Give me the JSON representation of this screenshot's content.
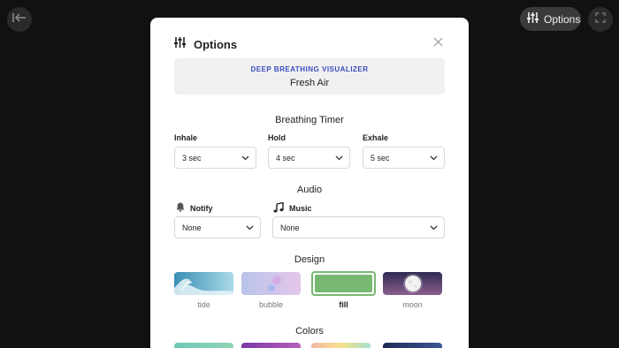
{
  "toolbar": {
    "back_icon": "exit-left-arrow-icon",
    "options_label": "Options",
    "options_icon": "sliders-icon",
    "expand_icon": "fullscreen-icon"
  },
  "modal": {
    "title": "Options",
    "title_icon": "sliders-icon",
    "close_icon": "close-icon",
    "subtitle": "DEEP BREATHING VISUALIZER",
    "preset_name": "Fresh Air",
    "accent_color": "#3b4dbf",
    "timer": {
      "heading": "Breathing Timer",
      "inhale": {
        "label": "Inhale",
        "value": "3 sec"
      },
      "hold": {
        "label": "Hold",
        "value": "4 sec"
      },
      "exhale": {
        "label": "Exhale",
        "value": "5 sec"
      }
    },
    "audio": {
      "heading": "Audio",
      "notify": {
        "label": "Notify",
        "icon": "bell-icon",
        "value": "None"
      },
      "music": {
        "label": "Music",
        "icon": "music-note-icon",
        "value": "None"
      }
    },
    "design": {
      "heading": "Design",
      "items": [
        {
          "label": "tide",
          "selected": false
        },
        {
          "label": "bubble",
          "selected": false
        },
        {
          "label": "fill",
          "selected": true,
          "color": "#77b872"
        },
        {
          "label": "moon",
          "selected": false
        }
      ]
    },
    "colors": {
      "heading": "Colors"
    }
  }
}
